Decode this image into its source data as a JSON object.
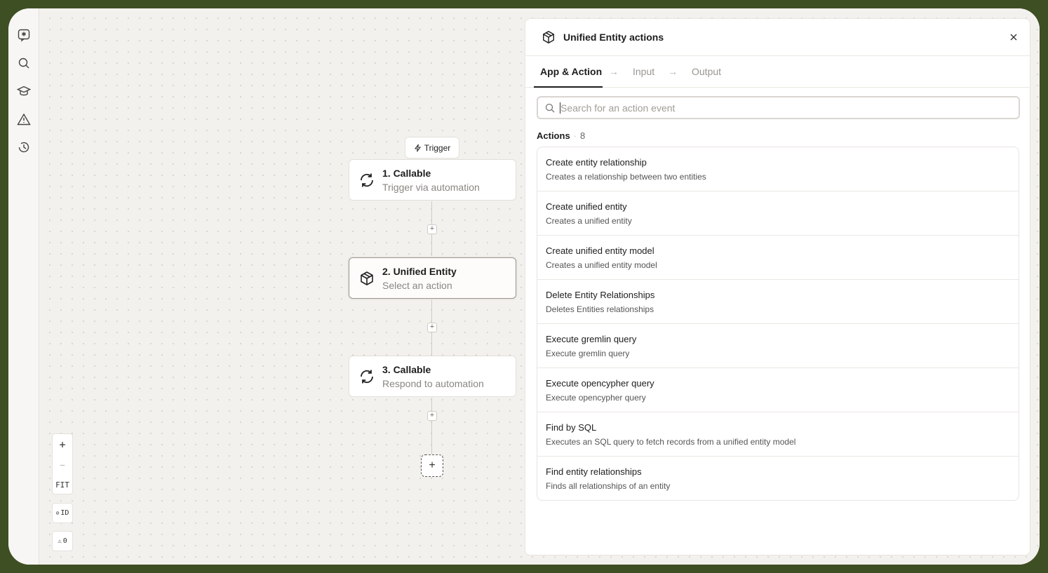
{
  "rail": {
    "icons": [
      "sparkle-chat-icon",
      "search-icon",
      "graduation-cap-icon",
      "warning-icon",
      "history-icon"
    ]
  },
  "canvas": {
    "trigger_label": "Trigger",
    "nodes": [
      {
        "title": "1. Callable",
        "subtitle": "Trigger via automation",
        "icon": "refresh-icon"
      },
      {
        "title": "2. Unified Entity",
        "subtitle": "Select an action",
        "icon": "cube-icon"
      },
      {
        "title": "3. Callable",
        "subtitle": "Respond to automation",
        "icon": "refresh-icon"
      }
    ],
    "zoom": {
      "in": "+",
      "out": "—",
      "fit": "FIT"
    },
    "id_toggle": "ID",
    "warnings": "0"
  },
  "panel": {
    "title": "Unified Entity actions",
    "tabs": [
      "App & Action",
      "Input",
      "Output"
    ],
    "active_tab": "App & Action",
    "search": {
      "placeholder": "Search for an action event",
      "value": ""
    },
    "actions_label": "Actions",
    "actions_count": "8",
    "actions": [
      {
        "title": "Create entity relationship",
        "desc": "Creates a relationship between two entities"
      },
      {
        "title": "Create unified entity",
        "desc": "Creates a unified entity"
      },
      {
        "title": "Create unified entity model",
        "desc": "Creates a unified entity model"
      },
      {
        "title": "Delete Entity Relationships",
        "desc": "Deletes Entities relationships"
      },
      {
        "title": "Execute gremlin query",
        "desc": "Execute gremlin query"
      },
      {
        "title": "Execute opencypher query",
        "desc": "Execute opencypher query"
      },
      {
        "title": "Find by SQL",
        "desc": "Executes an SQL query to fetch records from a unified entity model"
      },
      {
        "title": "Find entity relationships",
        "desc": "Finds all relationships of an entity"
      }
    ]
  }
}
